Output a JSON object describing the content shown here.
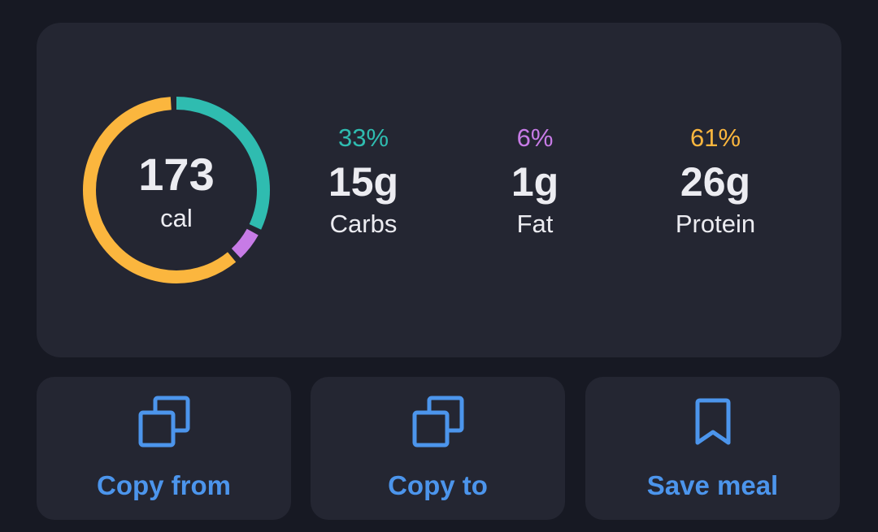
{
  "colors": {
    "background": "#171923",
    "card": "#242632",
    "carbs": "#2fbcb0",
    "fat": "#c77be6",
    "protein": "#fbb63e",
    "action": "#4c95ec",
    "text": "#ececf1"
  },
  "summary": {
    "calories": "173",
    "calories_unit": "cal",
    "macros": [
      {
        "key": "carbs",
        "percent": "33%",
        "percent_value": 33,
        "grams": "15g",
        "label": "Carbs"
      },
      {
        "key": "fat",
        "percent": "6%",
        "percent_value": 6,
        "grams": "1g",
        "label": "Fat"
      },
      {
        "key": "protein",
        "percent": "61%",
        "percent_value": 61,
        "grams": "26g",
        "label": "Protein"
      }
    ]
  },
  "actions": [
    {
      "label": "Copy from",
      "icon": "copy-icon"
    },
    {
      "label": "Copy to",
      "icon": "copy-icon"
    },
    {
      "label": "Save meal",
      "icon": "bookmark-icon"
    }
  ]
}
